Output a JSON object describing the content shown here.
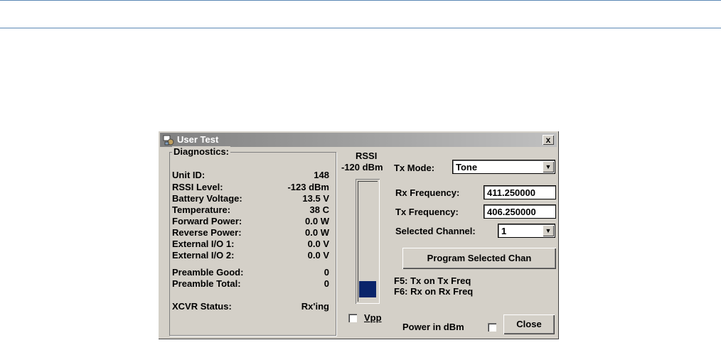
{
  "window": {
    "title": "User Test",
    "close_glyph": "x"
  },
  "diagnostics": {
    "group_title": "Diagnostics:",
    "rows": [
      {
        "label": "Unit ID:",
        "value": "148"
      },
      {
        "label": "RSSI Level:",
        "value": "-123 dBm"
      },
      {
        "label": "Battery Voltage:",
        "value": "13.5 V"
      },
      {
        "label": "Temperature:",
        "value": "38 C"
      },
      {
        "label": "Forward Power:",
        "value": "0.0 W"
      },
      {
        "label": "Reverse Power:",
        "value": "0.0 W"
      },
      {
        "label": "External I/O 1:",
        "value": "0.0 V"
      },
      {
        "label": "External I/O 2:",
        "value": "0.0 V"
      },
      {
        "label": "Preamble Good:",
        "value": "0"
      },
      {
        "label": "Preamble Total:",
        "value": "0"
      },
      {
        "label": "XCVR Status:",
        "value": "Rx'ing"
      }
    ]
  },
  "rssi": {
    "title": "RSSI",
    "reading": "-120 dBm",
    "fill_fraction": 0.14,
    "fill_color": "#0a246a",
    "vpp_label": "Vpp",
    "vpp_checked": false
  },
  "controls": {
    "tx_mode_label": "Tx Mode:",
    "tx_mode_value": "Tone",
    "rx_freq_label": "Rx Frequency:",
    "rx_freq_value": "411.250000",
    "tx_freq_label": "Tx Frequency:",
    "tx_freq_value": "406.250000",
    "channel_label": "Selected Channel:",
    "channel_value": "1",
    "program_button": "Program Selected Chan",
    "hint_f5": "F5: Tx on Tx Freq",
    "hint_f6": "F6: Rx on Rx Freq",
    "power_dbm_label": "Power in dBm",
    "power_dbm_checked": false,
    "close_button": "Close"
  },
  "colors": {
    "rule_line": "#5b87b5",
    "dialog_bg": "#d4d0c8"
  }
}
